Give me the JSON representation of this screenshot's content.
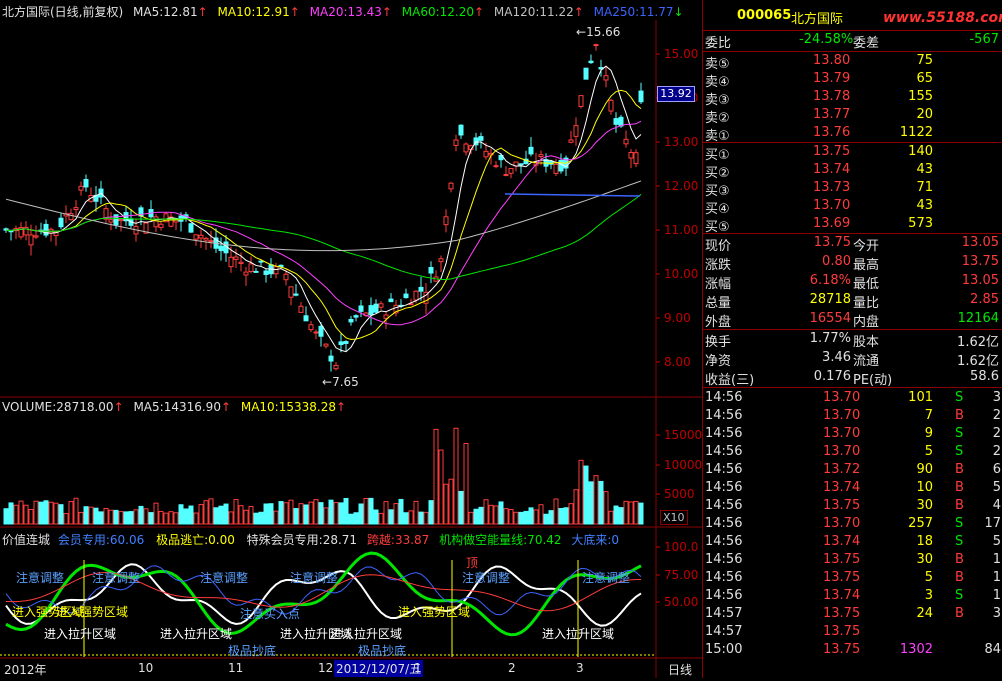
{
  "chart": {
    "header": {
      "title": "北方国际(日线,前复权)",
      "ma5": "MA5:12.81",
      "ma10": "MA10:12.91",
      "ma20": "MA20:13.43",
      "ma60": "MA60:12.20",
      "ma120": "MA120:11.22",
      "ma250": "MA250:11.77"
    },
    "price_axis": [
      "15.00",
      "14.00",
      "13.00",
      "12.00",
      "11.00",
      "10.00",
      "9.00",
      "8.00"
    ],
    "current_price_tag": "13.92",
    "high_label": "15.66",
    "low_label": "7.65",
    "volume": {
      "label": "VOLUME:28718.00",
      "ma5": "MA5:14316.90",
      "ma10": "MA10:15338.28",
      "axis": [
        "15000",
        "10000",
        "5000"
      ],
      "unit": "X10"
    },
    "indicator": {
      "name": "价值连城",
      "member": "会员专用:60.06",
      "escape": "极品逃亡:0.00",
      "special": "特殊会员专用:28.71",
      "leap": "跨越:33.87",
      "inst": "机构做空能量线:70.42",
      "bottom": "大底来:0",
      "axis": [
        "100.0",
        "75.00",
        "50.00"
      ],
      "labels": {
        "attention": "注意调整",
        "strong": "进入强势区域",
        "pull": "进入拉升区域",
        "entry": "注意买入点",
        "bottom_zone": "极品抄底",
        "top": "顶"
      }
    },
    "date_axis": {
      "items": [
        "2012年",
        "10",
        "11",
        "12",
        "2012/12/07/五",
        "1",
        "2",
        "3"
      ],
      "period": "日线"
    }
  },
  "quote": {
    "code": "000065",
    "name": "北方国际",
    "site": "www.55188.com",
    "weibi_label": "委比",
    "weibi_value": "-24.58%",
    "weicha_label": "委差",
    "weicha_value": "-567",
    "asks": [
      {
        "label": "卖⑤",
        "price": "13.80",
        "vol": "75"
      },
      {
        "label": "卖④",
        "price": "13.79",
        "vol": "65"
      },
      {
        "label": "卖③",
        "price": "13.78",
        "vol": "155"
      },
      {
        "label": "卖②",
        "price": "13.77",
        "vol": "20"
      },
      {
        "label": "卖①",
        "price": "13.76",
        "vol": "1122"
      }
    ],
    "bids": [
      {
        "label": "买①",
        "price": "13.75",
        "vol": "140"
      },
      {
        "label": "买②",
        "price": "13.74",
        "vol": "43"
      },
      {
        "label": "买③",
        "price": "13.73",
        "vol": "71"
      },
      {
        "label": "买④",
        "price": "13.70",
        "vol": "43"
      },
      {
        "label": "买⑤",
        "price": "13.69",
        "vol": "573"
      }
    ],
    "stats": [
      {
        "l1": "现价",
        "v1": "13.75",
        "c1": "red",
        "l2": "今开",
        "v2": "13.05",
        "c2": "red"
      },
      {
        "l1": "涨跌",
        "v1": "0.80",
        "c1": "red",
        "l2": "最高",
        "v2": "13.75",
        "c2": "red"
      },
      {
        "l1": "涨幅",
        "v1": "6.18%",
        "c1": "red",
        "l2": "最低",
        "v2": "13.05",
        "c2": "red"
      },
      {
        "l1": "总量",
        "v1": "28718",
        "c1": "yellow",
        "l2": "量比",
        "v2": "2.85",
        "c2": "red"
      },
      {
        "l1": "外盘",
        "v1": "16554",
        "c1": "red",
        "l2": "内盘",
        "v2": "12164",
        "c2": "green"
      }
    ],
    "fundamentals": [
      {
        "l1": "换手",
        "v1": "1.77%",
        "l2": "股本",
        "v2": "1.62亿"
      },
      {
        "l1": "净资",
        "v1": "3.46",
        "l2": "流通",
        "v2": "1.62亿"
      },
      {
        "l1": "收益(三)",
        "v1": "0.176",
        "l2": "PE(动)",
        "v2": "58.6"
      }
    ],
    "ticks": [
      {
        "t": "14:56",
        "p": "13.70",
        "v": "101",
        "d": "S",
        "n": "3"
      },
      {
        "t": "14:56",
        "p": "13.70",
        "v": "7",
        "d": "B",
        "n": "2"
      },
      {
        "t": "14:56",
        "p": "13.70",
        "v": "9",
        "d": "S",
        "n": "2"
      },
      {
        "t": "14:56",
        "p": "13.70",
        "v": "5",
        "d": "S",
        "n": "2"
      },
      {
        "t": "14:56",
        "p": "13.72",
        "v": "90",
        "d": "B",
        "n": "6"
      },
      {
        "t": "14:56",
        "p": "13.74",
        "v": "10",
        "d": "B",
        "n": "5"
      },
      {
        "t": "14:56",
        "p": "13.75",
        "v": "30",
        "d": "B",
        "n": "4"
      },
      {
        "t": "14:56",
        "p": "13.70",
        "v": "257",
        "d": "S",
        "n": "17"
      },
      {
        "t": "14:56",
        "p": "13.74",
        "v": "18",
        "d": "S",
        "n": "5"
      },
      {
        "t": "14:56",
        "p": "13.75",
        "v": "30",
        "d": "B",
        "n": "1"
      },
      {
        "t": "14:56",
        "p": "13.75",
        "v": "5",
        "d": "B",
        "n": "1"
      },
      {
        "t": "14:56",
        "p": "13.74",
        "v": "3",
        "d": "S",
        "n": "1"
      },
      {
        "t": "14:57",
        "p": "13.75",
        "v": "24",
        "d": "B",
        "n": "3"
      },
      {
        "t": "14:57",
        "p": "13.75",
        "v": "",
        "d": "",
        "n": ""
      },
      {
        "t": "15:00",
        "p": "13.75",
        "v": "1302",
        "d": "",
        "n": "84"
      }
    ]
  }
}
